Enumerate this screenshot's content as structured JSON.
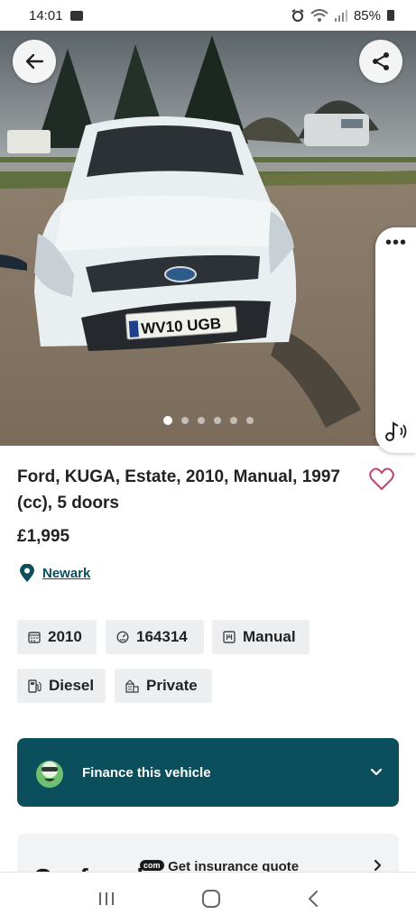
{
  "status_bar": {
    "time": "14:01",
    "battery": "85%",
    "icons": [
      "gallery-icon",
      "alarm-icon",
      "wifi-icon",
      "signal-icon",
      "battery-icon"
    ]
  },
  "hero": {
    "photo_subject": "White Ford Kuga estate parked on gravel",
    "plate_text": "WV10 UGB",
    "image_count": 6,
    "active_image_index": 0,
    "back_icon": "arrow-left-icon",
    "share_icon": "share-icon"
  },
  "side_panel": {
    "more_label": "•••",
    "music_icon": "music-note-icon"
  },
  "listing": {
    "title": "Ford, KUGA, Estate, 2010, Manual, 1997 (cc), 5 doors",
    "price": "£1,995",
    "location": "Newark",
    "favourite_icon": "heart-outline-icon"
  },
  "specs": {
    "year": "2010",
    "mileage": "164314",
    "transmission": "Manual",
    "fuel": "Diesel",
    "seller": "Private"
  },
  "finance": {
    "label": "Finance this vehicle"
  },
  "insurance": {
    "brand": "Confused",
    "brand_badge": "com",
    "label": "Get insurance quote"
  },
  "nav": {
    "recent": "recent-apps-icon",
    "home": "home-icon",
    "back": "back-chevron-icon"
  },
  "colors": {
    "accent": "#0b4f5c",
    "chip_bg": "#eceef0",
    "heart": "#c0446b"
  }
}
